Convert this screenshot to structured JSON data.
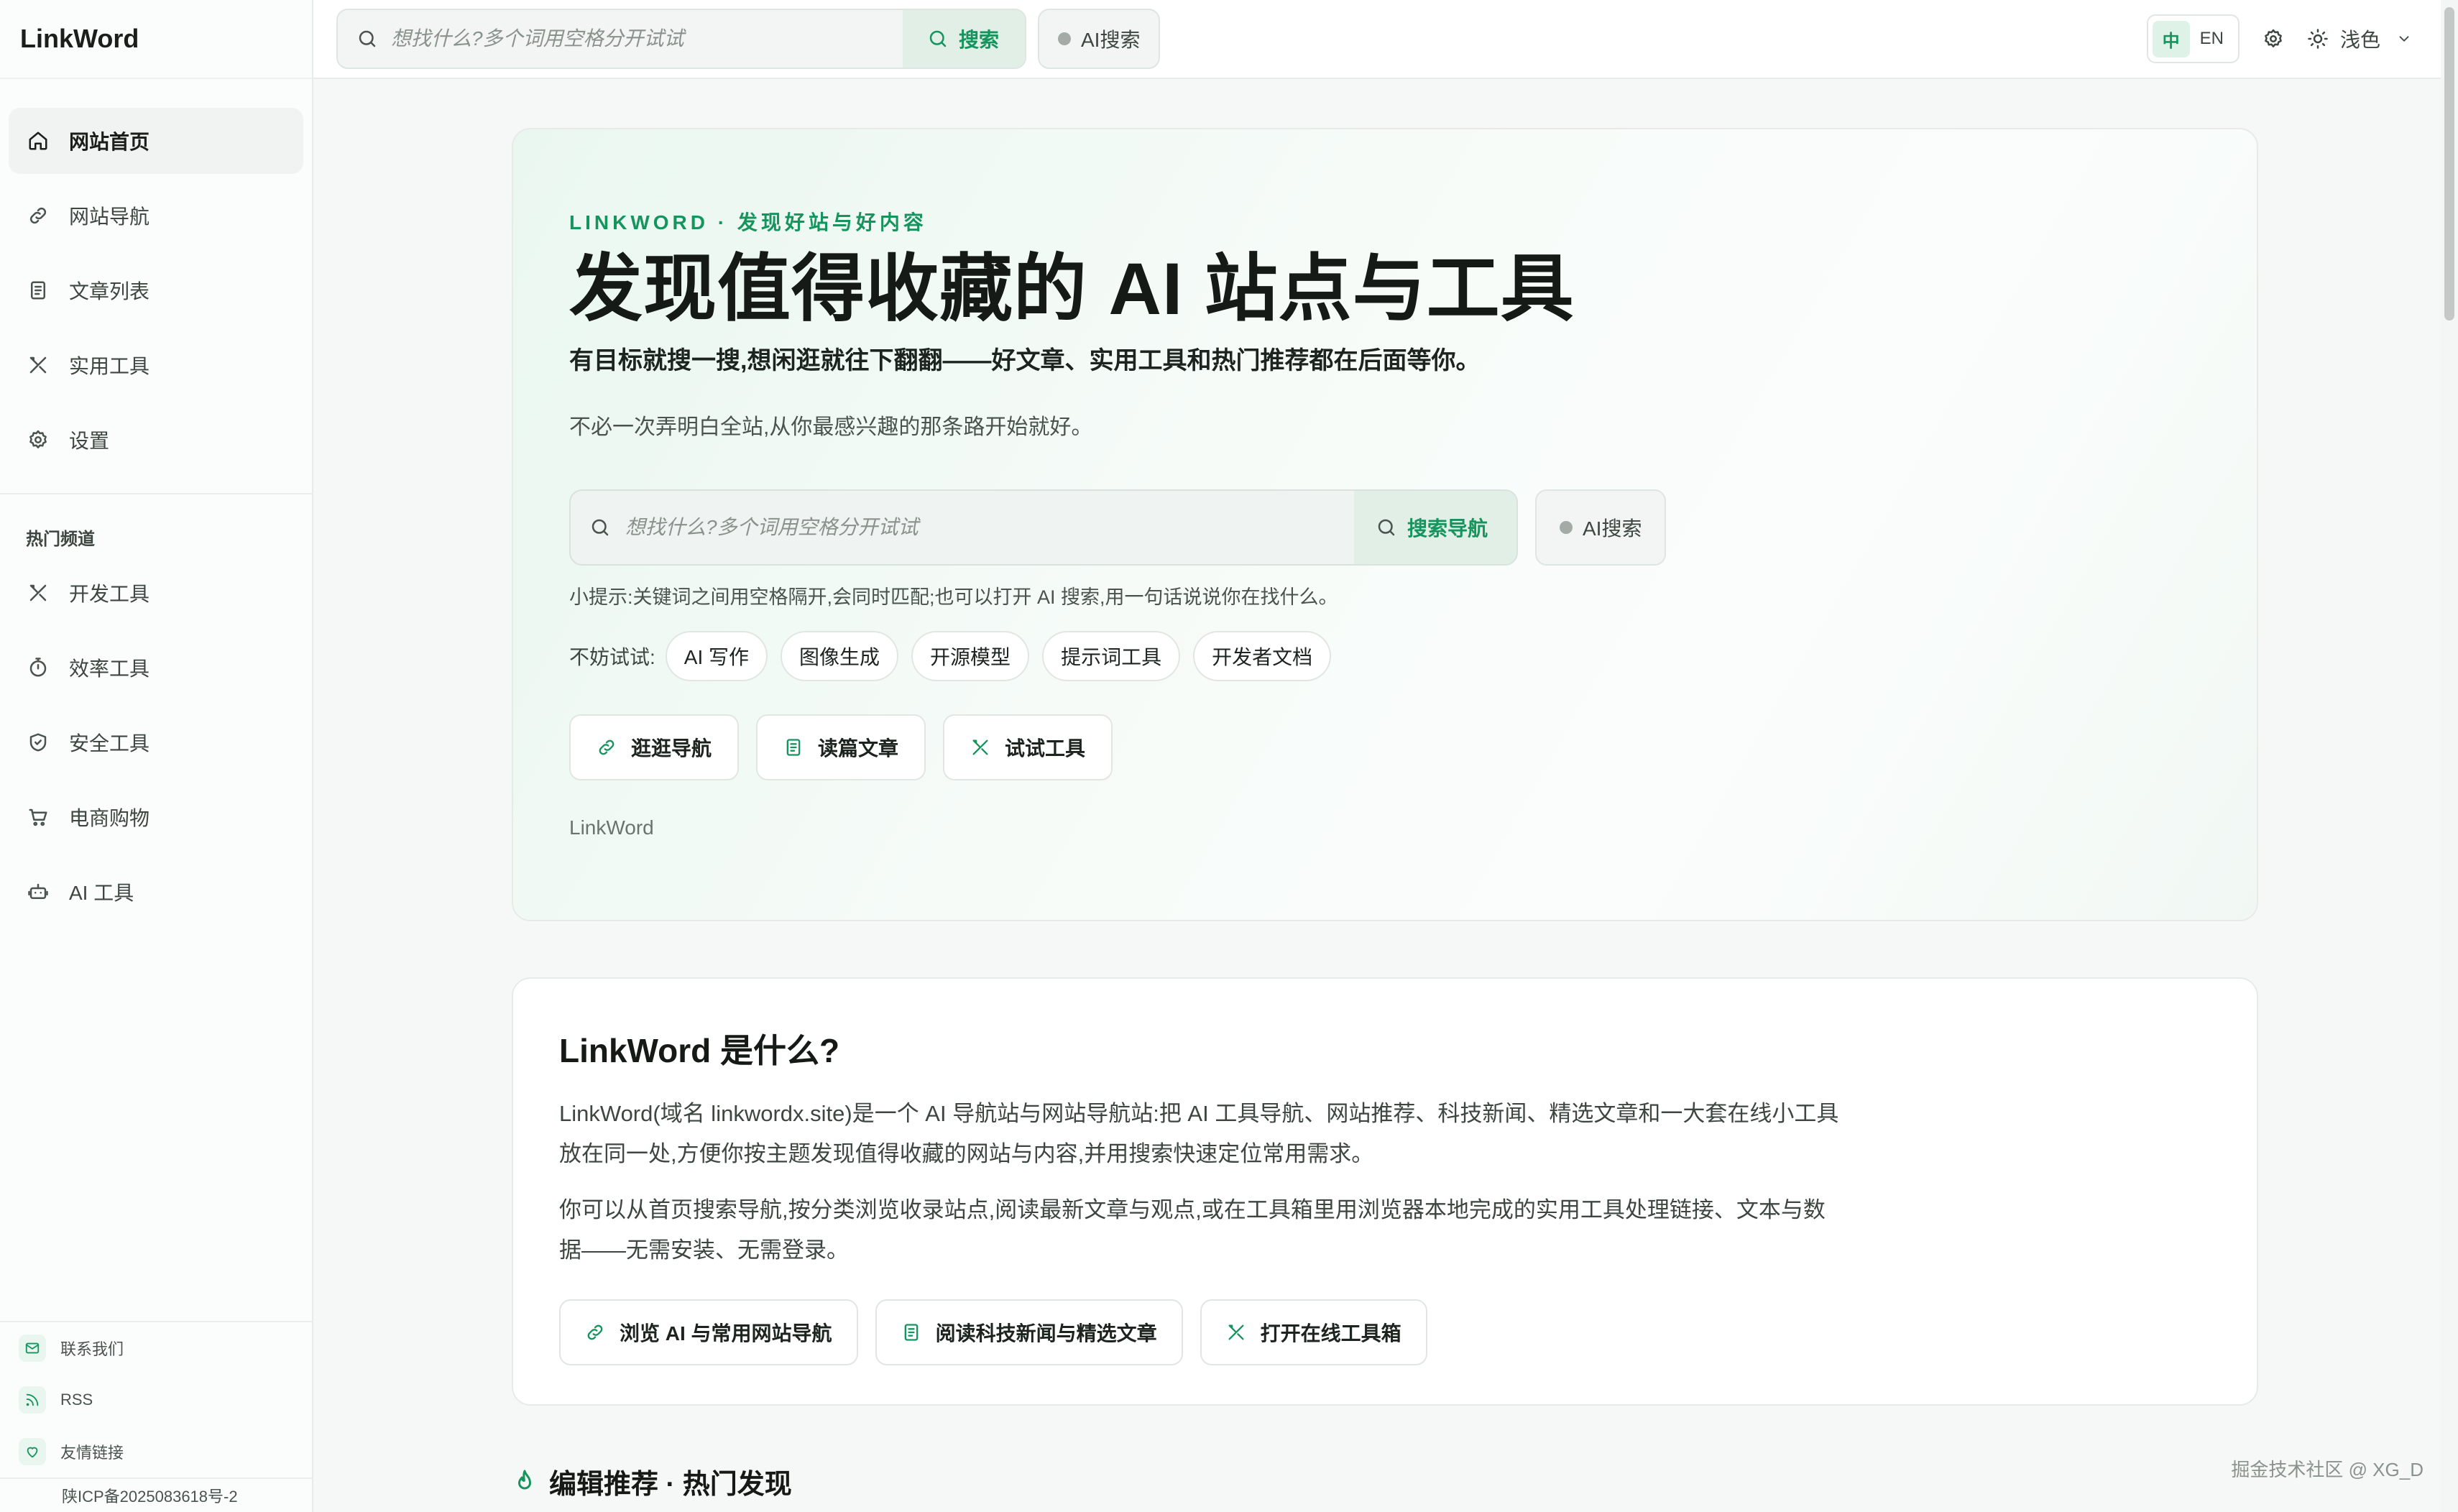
{
  "brand": "LinkWord",
  "nav": [
    {
      "label": "网站首页",
      "icon": "home-icon",
      "active": true
    },
    {
      "label": "网站导航",
      "icon": "link-icon"
    },
    {
      "label": "文章列表",
      "icon": "document-icon"
    },
    {
      "label": "实用工具",
      "icon": "tools-icon"
    },
    {
      "label": "设置",
      "icon": "gear-icon"
    }
  ],
  "hot_section_title": "热门频道",
  "hot": [
    {
      "label": "开发工具",
      "icon": "tools-icon"
    },
    {
      "label": "效率工具",
      "icon": "timer-icon"
    },
    {
      "label": "安全工具",
      "icon": "shield-icon"
    },
    {
      "label": "电商购物",
      "icon": "cart-icon"
    },
    {
      "label": "AI 工具",
      "icon": "robot-icon"
    }
  ],
  "footer": {
    "contact": "联系我们",
    "rss": "RSS",
    "friends": "友情链接",
    "icp": "陕ICP备2025083618号-2"
  },
  "topbar": {
    "search_placeholder": "想找什么?多个词用空格分开试试",
    "search_label": "搜索",
    "ai_label": "AI搜索",
    "lang_zh": "中",
    "lang_en": "EN",
    "theme_label": "浅色"
  },
  "hero": {
    "eyebrow": "LINKWORD · 发现好站与好内容",
    "title": "发现值得收藏的 AI 站点与工具",
    "sub1": "有目标就搜一搜,想闲逛就往下翻翻——好文章、实用工具和热门推荐都在后面等你。",
    "sub2": "不必一次弄明白全站,从你最感兴趣的那条路开始就好。",
    "search_placeholder": "想找什么?多个词用空格分开试试",
    "search_label": "搜索导航",
    "ai_label": "AI搜索",
    "tip": "小提示:关键词之间用空格隔开,会同时匹配;也可以打开 AI 搜索,用一句话说说你在找什么。",
    "try_label": "不妨试试:",
    "chips": [
      "AI 写作",
      "图像生成",
      "开源模型",
      "提示词工具",
      "开发者文档"
    ],
    "actions": [
      {
        "label": "逛逛导航",
        "icon": "link-icon"
      },
      {
        "label": "读篇文章",
        "icon": "document-icon"
      },
      {
        "label": "试试工具",
        "icon": "tools-icon"
      }
    ],
    "foot": "LinkWord"
  },
  "about": {
    "title": "LinkWord 是什么?",
    "p1": "LinkWord(域名 linkwordx.site)是一个 AI 导航站与网站导航站:把 AI 工具导航、网站推荐、科技新闻、精选文章和一大套在线小工具放在同一处,方便你按主题发现值得收藏的网站与内容,并用搜索快速定位常用需求。",
    "p2": "你可以从首页搜索导航,按分类浏览收录站点,阅读最新文章与观点,或在工具箱里用浏览器本地完成的实用工具处理链接、文本与数据——无需安装、无需登录。",
    "actions": [
      {
        "label": "浏览 AI 与常用网站导航",
        "icon": "link-icon"
      },
      {
        "label": "阅读科技新闻与精选文章",
        "icon": "document-icon"
      },
      {
        "label": "打开在线工具箱",
        "icon": "tools-icon"
      }
    ]
  },
  "editor_title": "编辑推荐 · 热门发现",
  "watermark": "掘金技术社区 @ XG_D",
  "colors": {
    "accent": "#16945e",
    "accent_bg": "#e1efe7"
  }
}
